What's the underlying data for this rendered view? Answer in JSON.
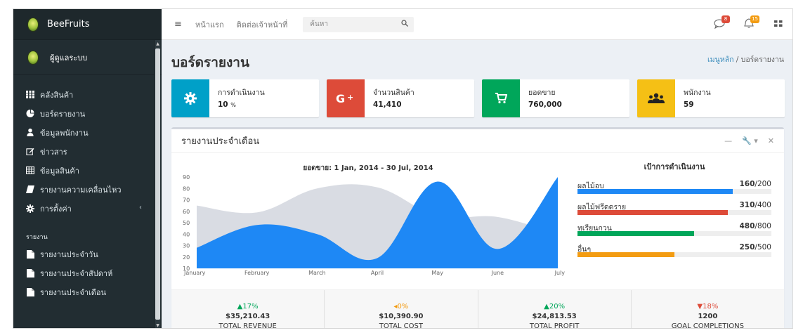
{
  "brand": {
    "name": "BeeFruits"
  },
  "user": {
    "name": "ผู้ดูแลระบบ"
  },
  "sidebar": {
    "items": [
      {
        "label": "คลังสินค้า",
        "icon": "grid-icon"
      },
      {
        "label": "บอร์ดรายงาน",
        "icon": "pie-chart-icon"
      },
      {
        "label": "ข้อมูลพนักงาน",
        "icon": "user-icon"
      },
      {
        "label": "ข่าวสาร",
        "icon": "edit-icon"
      },
      {
        "label": "ข้อมูลสินค้า",
        "icon": "table-icon"
      },
      {
        "label": "รายงานความเคลื่อนไหว",
        "icon": "eraser-icon"
      },
      {
        "label": "การตั้งค่า",
        "icon": "gear-icon",
        "chevron": "‹"
      }
    ],
    "section_header": "รายงาน",
    "report_items": [
      {
        "label": "รายงานประจำวัน",
        "icon": "file-icon"
      },
      {
        "label": "รายงานประจำสัปดาห์",
        "icon": "file-icon"
      },
      {
        "label": "รายงานประจำเดือน",
        "icon": "file-icon"
      }
    ]
  },
  "topbar": {
    "links": [
      "หน้าแรก",
      "ติดต่อเจ้าหน้าที่"
    ],
    "search_placeholder": "ค้นหา",
    "messages_badge": "8",
    "notifications_badge": "15"
  },
  "page": {
    "title": "บอร์ดรายงาน",
    "breadcrumb_home": "เมนูหลัก",
    "breadcrumb_sep": "/",
    "breadcrumb_current": "บอร์ดรายงาน"
  },
  "info_boxes": [
    {
      "label": "การดำเนินงาน",
      "value": "10",
      "unit": "%",
      "color": "#00a0c8",
      "icon": "gear-icon"
    },
    {
      "label": "จำนวนสินค้า",
      "value": "41,410",
      "unit": "",
      "color": "#dd4b39",
      "icon": "google-plus-icon"
    },
    {
      "label": "ยอดขาย",
      "value": "760,000",
      "unit": "",
      "color": "#00a65a",
      "icon": "cart-icon"
    },
    {
      "label": "พนักงาน",
      "value": "59",
      "unit": "",
      "color": "#f39c12",
      "icon": "users-icon"
    }
  ],
  "report_box": {
    "title": "รายงานประจำเดือน",
    "tools": [
      "—",
      "🔧 ▾",
      "✕"
    ]
  },
  "chart_data": {
    "type": "area",
    "title": "ยอดขาย: 1 Jan, 2014 - 30 Jul, 2014",
    "categories": [
      "January",
      "February",
      "March",
      "April",
      "May",
      "June",
      "July"
    ],
    "series": [
      {
        "values": [
          65,
          59,
          80,
          81,
          56,
          55,
          40
        ],
        "color": "#d2d6de"
      },
      {
        "values": [
          28,
          48,
          40,
          19,
          86,
          27,
          90
        ],
        "color": "#1e88f5"
      }
    ],
    "ylim": [
      10,
      90
    ],
    "yticks": [
      90,
      80,
      70,
      60,
      50,
      40,
      30,
      20,
      10
    ]
  },
  "goals": {
    "title": "เป้าการดำเนินงาน",
    "items": [
      {
        "label": "ผลไม้อบ",
        "value": "160",
        "total": "/200",
        "fraction": 0.8,
        "color": "#1e88f5"
      },
      {
        "label": "ผลไม้ฟรีดดราย",
        "value": "310",
        "total": "/400",
        "fraction": 0.775,
        "color": "#dd4b39"
      },
      {
        "label": "ทุเรียนกวน",
        "value": "480",
        "total": "/800",
        "fraction": 0.6,
        "color": "#00a65a"
      },
      {
        "label": "อื่นๆ",
        "value": "250",
        "total": "/500",
        "fraction": 0.5,
        "color": "#f39c12"
      }
    ]
  },
  "stats": [
    {
      "pct": "▲17%",
      "amount": "$35,210.43",
      "label": "TOTAL REVENUE",
      "color": "#00a65a"
    },
    {
      "pct": "◂0%",
      "amount": "$10,390.90",
      "label": "TOTAL COST",
      "color": "#f39c12"
    },
    {
      "pct": "▲20%",
      "amount": "$24,813.53",
      "label": "TOTAL PROFIT",
      "color": "#00a65a"
    },
    {
      "pct": "▼18%",
      "amount": "1200",
      "label": "GOAL COMPLETIONS",
      "color": "#dd4b39"
    }
  ]
}
